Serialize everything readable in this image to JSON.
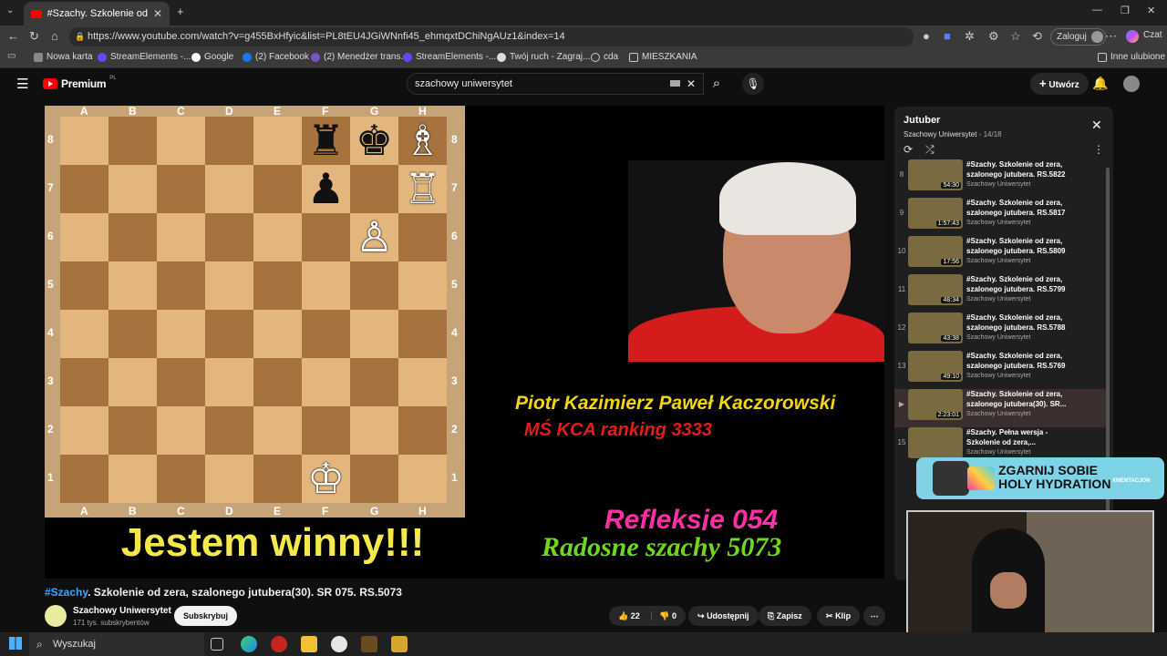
{
  "browser": {
    "tab_title": "#Szachy. Szkolenie od zera, sz",
    "url": "https://www.youtube.com/watch?v=g455BxHfyic&list=PL8tEU4JGiWNnfi45_ehmqxtDChiNgAUz1&index=14",
    "profile_label": "Zaloguj",
    "chat_label": "Czat",
    "bookmarks": [
      "Nowa karta",
      "StreamElements -...",
      "Google",
      "(2) Facebook",
      "(2) Menedżer trans...",
      "StreamElements -...",
      "Twój ruch - Zagraj...",
      "cda",
      "MIESZKANIA"
    ],
    "other_bookmarks": "Inne ulubione"
  },
  "youtube": {
    "logo": "Premium",
    "logo_suffix": "PL",
    "search_value": "szachowy uniwersytet",
    "create_label": "Utwórz"
  },
  "video": {
    "board_files": [
      "A",
      "B",
      "C",
      "D",
      "E",
      "F",
      "G",
      "H"
    ],
    "board_ranks": [
      "8",
      "7",
      "6",
      "5",
      "4",
      "3",
      "2",
      "1"
    ],
    "pieces": [
      {
        "square": "F8",
        "glyph": "♜",
        "color": "black"
      },
      {
        "square": "G8",
        "glyph": "♚",
        "color": "black"
      },
      {
        "square": "H8",
        "glyph": "♗",
        "color": "white"
      },
      {
        "square": "F7",
        "glyph": "♟",
        "color": "black"
      },
      {
        "square": "H7",
        "glyph": "♖",
        "color": "white"
      },
      {
        "square": "G6",
        "glyph": "♙",
        "color": "white"
      },
      {
        "square": "F1",
        "glyph": "♔",
        "color": "white"
      }
    ],
    "caption": "Jestem winny!!!",
    "name_text": "Piotr Kazimierz Paweł Kaczorowski",
    "rank_text": "MŚ KCA ranking 3333",
    "refleksje_text": "Refleksje 054",
    "radosne_text": "Radosne szachy 5073",
    "colors": {
      "light_square": "#e2b67d",
      "dark_square": "#a6733e",
      "caption": "#f5e84a"
    }
  },
  "meta": {
    "hashtag": "#Szachy",
    "title_rest": ". Szkolenie od zera, szalonego jutubera(30). SR 075. RS.5073",
    "channel": "Szachowy Uniwersytet",
    "subscribers": "171 tys. subskrybentów",
    "subscribe": "Subskrybuj",
    "likes": "22",
    "dislikes": "0",
    "share": "Udostępnij",
    "save": "Zapisz",
    "clip": "Klip",
    "more": "⋯"
  },
  "playlist": {
    "title": "Jutuber",
    "channel": "Szachowy Uniwersytet",
    "position": " - 14/18",
    "items": [
      {
        "num": "8",
        "title": "#Szachy. Szkolenie od zera, szalonego jutubera. RS.5822",
        "channel": "Szachowy Uniwersytet",
        "duration": "54:30"
      },
      {
        "num": "9",
        "title": "#Szachy. Szkolenie od zera, szalonego jutubera. RS.5817",
        "channel": "Szachowy Uniwersytet",
        "duration": "1:57:43"
      },
      {
        "num": "10",
        "title": "#Szachy. Szkolenie od zera, szalonego jutubera. RS.5809",
        "channel": "Szachowy Uniwersytet",
        "duration": "17:56"
      },
      {
        "num": "11",
        "title": "#Szachy. Szkolenie od zera, szalonego jutubera. RS.5799",
        "channel": "Szachowy Uniwersytet",
        "duration": "48:34"
      },
      {
        "num": "12",
        "title": "#Szachy. Szkolenie od zera, szalonego jutubera. RS.5788",
        "channel": "Szachowy Uniwersytet",
        "duration": "43:38"
      },
      {
        "num": "13",
        "title": "#Szachy. Szkolenie od zera, szalonego jutubera. RS.5769",
        "channel": "Szachowy Uniwersytet",
        "duration": "49:10"
      },
      {
        "num": "▶",
        "title": "#Szachy. Szkolenie od zera, szalonego jutubera(30). SR...",
        "channel": "Szachowy Uniwersytet",
        "duration": "2:23:01",
        "active": true
      },
      {
        "num": "15",
        "title": "#Szachy. Pełna wersja - Szkolenie od zera,...",
        "channel": "Szachowy Uniwersytet",
        "duration": ""
      }
    ]
  },
  "ad": {
    "text_line1": "ZGARNIJ SOBIE",
    "text_line2": "HOLY HYDRATION",
    "brand": "XMENTACJON"
  },
  "taskbar": {
    "search_placeholder": "Wyszukaj"
  }
}
